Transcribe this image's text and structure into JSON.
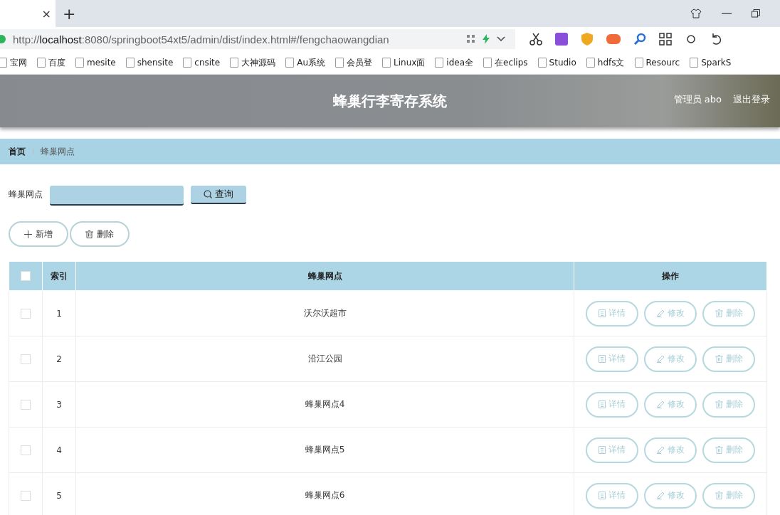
{
  "browser": {
    "tab_close": "×",
    "new_tab": "+",
    "url_prefix": "http://",
    "url_host": "localhost",
    "url_rest": ":8080/springboot54xt5/admin/dist/index.html#/fengchaowangdian",
    "bookmarks": [
      "宝网",
      "百度",
      "mesite",
      "shensite",
      "cnsite",
      "大神源码",
      "Au系统",
      "会员登",
      "Linux面",
      "idea全",
      "在eclips",
      "Studio",
      "hdfs文",
      "Resourc",
      "SparkS"
    ]
  },
  "header": {
    "title": "蜂巢行李寄存系统",
    "user": "管理员 abo",
    "logout": "退出登录"
  },
  "breadcrumb": [
    {
      "label": "首页",
      "selected": false
    },
    {
      "label": "蜂巢网点",
      "selected": true
    }
  ],
  "search": {
    "label": "蜂巢网点",
    "button": "查询"
  },
  "actions": [
    {
      "kind": "add",
      "label": "新增"
    },
    {
      "kind": "delete",
      "label": "删除"
    }
  ],
  "table": {
    "columns": [
      "索引",
      "蜂巢网点",
      "操作"
    ],
    "select_all": false,
    "rows": [
      {
        "index": "1",
        "name": "沃尔沃超市",
        "checked": false,
        "actions": [
          {
            "kind": "detail",
            "label": "详情"
          },
          {
            "kind": "edit",
            "label": "修改"
          },
          {
            "kind": "delete",
            "label": "删除"
          }
        ]
      },
      {
        "index": "2",
        "name": "沿江公园",
        "checked": false,
        "actions": [
          {
            "kind": "detail",
            "label": "详情"
          },
          {
            "kind": "edit",
            "label": "修改"
          },
          {
            "kind": "delete",
            "label": "删除"
          }
        ]
      },
      {
        "index": "3",
        "name": "蜂巢网点4",
        "checked": false,
        "actions": [
          {
            "kind": "detail",
            "label": "详情"
          },
          {
            "kind": "edit",
            "label": "修改"
          },
          {
            "kind": "delete",
            "label": "删除"
          }
        ]
      },
      {
        "index": "4",
        "name": "蜂巢网点5",
        "checked": false,
        "actions": [
          {
            "kind": "detail",
            "label": "详情"
          },
          {
            "kind": "edit",
            "label": "修改"
          },
          {
            "kind": "delete",
            "label": "删除"
          }
        ]
      },
      {
        "index": "5",
        "name": "蜂巢网点6",
        "checked": false,
        "actions": [
          {
            "kind": "detail",
            "label": "详情"
          },
          {
            "kind": "edit",
            "label": "修改"
          },
          {
            "kind": "delete",
            "label": "删除"
          }
        ]
      }
    ]
  }
}
